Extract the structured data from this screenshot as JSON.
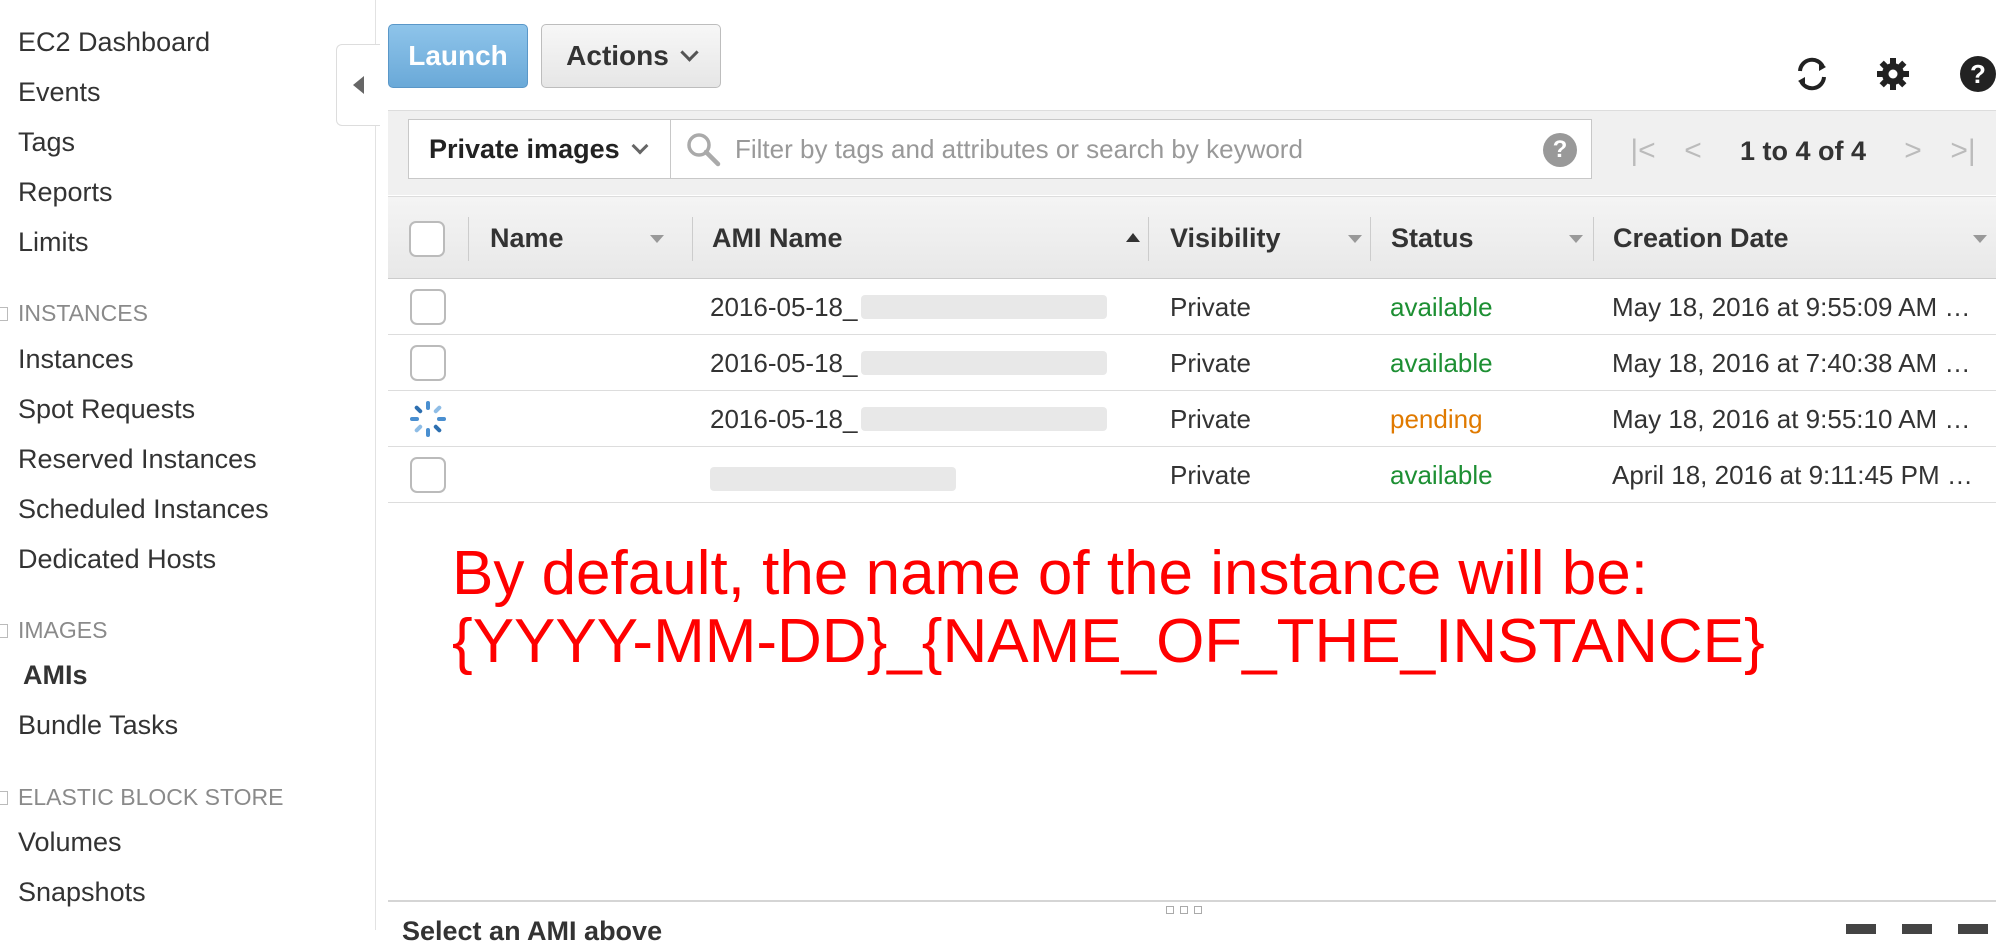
{
  "sidebar": {
    "top_items": [
      "EC2 Dashboard",
      "Events",
      "Tags",
      "Reports",
      "Limits"
    ],
    "sections": [
      {
        "title": "INSTANCES",
        "items": [
          "Instances",
          "Spot Requests",
          "Reserved Instances",
          "Scheduled Instances",
          "Dedicated Hosts"
        ]
      },
      {
        "title": "IMAGES",
        "items": [
          "AMIs",
          "Bundle Tasks"
        ]
      },
      {
        "title": "ELASTIC BLOCK STORE",
        "items": [
          "Volumes",
          "Snapshots"
        ]
      }
    ],
    "active_item": "AMIs"
  },
  "toolbar": {
    "launch_label": "Launch",
    "actions_label": "Actions",
    "icons": [
      "refresh-icon",
      "gear-icon",
      "help-icon"
    ]
  },
  "filter": {
    "image_type": "Private images",
    "search_placeholder": "Filter by tags and attributes or search by keyword",
    "pager_text": "1 to 4 of 4"
  },
  "table": {
    "columns": [
      "Name",
      "AMI Name",
      "Visibility",
      "Status",
      "Creation Date"
    ],
    "sorted_column": "AMI Name",
    "rows": [
      {
        "name": "",
        "ami_name": "2016-05-18_",
        "visibility": "Private",
        "status": "available",
        "creation_date": "May 18, 2016 at 9:55:09 AM …"
      },
      {
        "name": "",
        "ami_name": "2016-05-18_",
        "visibility": "Private",
        "status": "available",
        "creation_date": "May 18, 2016 at 7:40:38 AM …"
      },
      {
        "name": "",
        "ami_name": "2016-05-18_",
        "visibility": "Private",
        "status": "pending",
        "creation_date": "May 18, 2016 at 9:55:10 AM …"
      },
      {
        "name": "",
        "ami_name": "",
        "visibility": "Private",
        "status": "available",
        "creation_date": "April 18, 2016 at 9:11:45 PM …"
      }
    ]
  },
  "annotation": {
    "line1": "By default, the name of the instance will be:",
    "line2": "{YYYY-MM-DD}_{NAME_OF_THE_INSTANCE}",
    "color": "#ff0000"
  },
  "bottom_pane": {
    "title": "Select an AMI above"
  },
  "colors": {
    "launch_button": "#7bb7e3",
    "status_available": "#1d8f33",
    "status_pending": "#e07a00"
  }
}
